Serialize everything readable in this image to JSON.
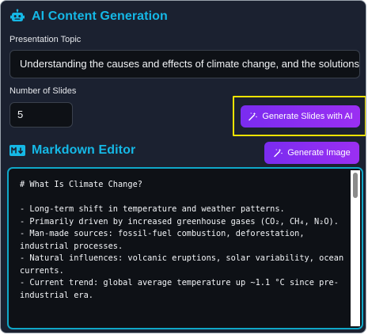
{
  "panel": {
    "title": "AI Content Generation",
    "icon": "robot-icon"
  },
  "topic": {
    "label": "Presentation Topic",
    "value": "Understanding the causes and effects of climate change, and the solutions t"
  },
  "slides": {
    "label": "Number of Slides",
    "value": "5"
  },
  "buttons": {
    "generate_slides": "Generate Slides with AI",
    "generate_image": "Generate Image",
    "icon": "magic-wand-icon"
  },
  "markdown": {
    "title": "Markdown Editor",
    "icon": "markdown-icon",
    "content": "# What Is Climate Change?\n\n- Long-term shift in temperature and weather patterns.\n- Primarily driven by increased greenhouse gases (CO₂, CH₄, N₂O).\n- Man-made sources: fossil-fuel combustion, deforestation, industrial processes.\n- Natural influences: volcanic eruptions, solar variability, ocean currents.\n- Current trend: global average temperature up ~1.1 °C since pre-industrial era."
  },
  "colors": {
    "panel_bg": "#1b2130",
    "accent_cyan": "#15b8e6",
    "button_purple": "#8b2ef2",
    "highlight_yellow": "#f2e300",
    "input_bg": "#0e1116"
  }
}
